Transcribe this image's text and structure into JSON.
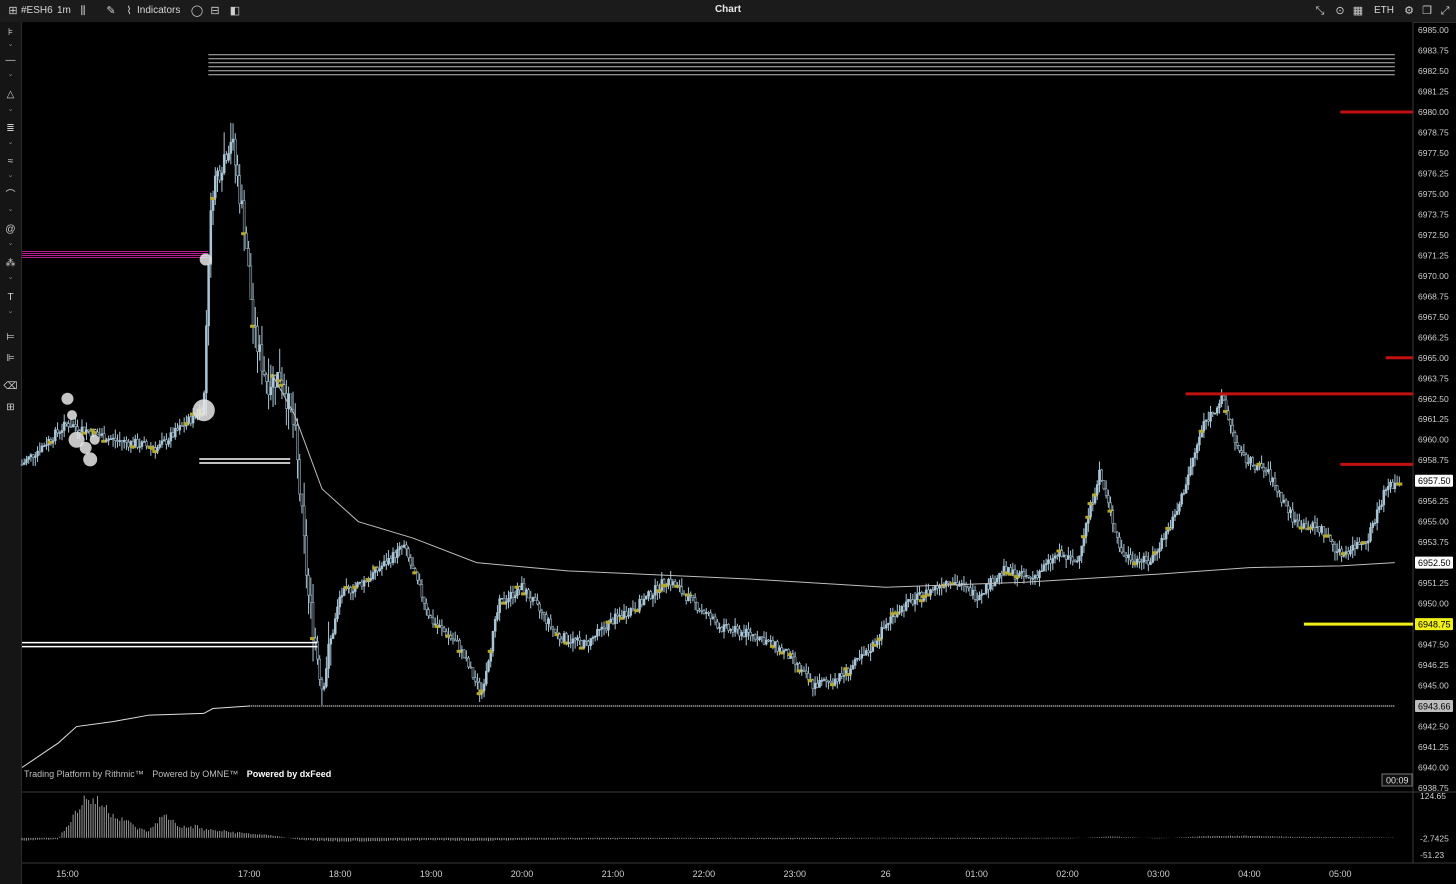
{
  "toolbar": {
    "symbol": "#ESH6",
    "interval": "1m",
    "indicators_label": "Indicators",
    "window_title": "Chart",
    "session": "ETH"
  },
  "left_tools": [
    "cursor-icon",
    "trendline-icon",
    "shapes-icon",
    "fib-icon",
    "pattern-icon",
    "curve-icon",
    "brush-icon",
    "elliott-icon",
    "text-icon",
    "measure-icon",
    "order-icon",
    "eraser-icon",
    "more-tools-icon"
  ],
  "attribution": {
    "rithmic": "Trading Platform by Rithmic™",
    "omne": "Powered by OMNE™",
    "dxfeed": "Powered by dxFeed"
  },
  "colors": {
    "background": "#000000",
    "candle": "#a9c7d8",
    "vwap": "#bdbdbd",
    "resistance": "#c01010",
    "target": "#f0f018",
    "marker": "#b8a82a",
    "magenta": "#b0208f"
  },
  "chart_data": {
    "type": "candlestick",
    "symbol": "#ESH6",
    "interval": "1m",
    "price_axis": {
      "ylim": [
        6938.75,
        6985.0
      ],
      "ticks": [
        "6985.00",
        "6983.75",
        "6982.50",
        "6981.25",
        "6980.00",
        "6978.75",
        "6977.50",
        "6976.25",
        "6975.00",
        "6973.75",
        "6972.50",
        "6971.25",
        "6970.00",
        "6968.75",
        "6967.50",
        "6966.25",
        "6965.00",
        "6963.75",
        "6962.50",
        "6961.25",
        "6960.00",
        "6958.75",
        "6957.50",
        "6956.25",
        "6955.00",
        "6953.75",
        "6952.50",
        "6951.25",
        "6950.00",
        "6948.75",
        "6947.50",
        "6946.25",
        "6945.00",
        "6943.75",
        "6942.50",
        "6941.25",
        "6940.00",
        "6938.75"
      ]
    },
    "time_axis": {
      "labels": [
        "15:00",
        "17:00",
        "18:00",
        "19:00",
        "20:00",
        "21:00",
        "22:00",
        "23:00",
        "26",
        "01:00",
        "02:00",
        "03:00",
        "04:00",
        "05:00"
      ],
      "xlim": [
        14.5,
        29.8
      ]
    },
    "price_path": [
      [
        14.5,
        6958.5
      ],
      [
        15.0,
        6961.0
      ],
      [
        15.5,
        6960.0
      ],
      [
        16.0,
        6959.5
      ],
      [
        16.5,
        6962.0
      ],
      [
        16.55,
        6971.0
      ],
      [
        16.6,
        6975.5
      ],
      [
        16.8,
        6978.5
      ],
      [
        16.95,
        6973.0
      ],
      [
        17.05,
        6966.5
      ],
      [
        17.2,
        6963.5
      ],
      [
        17.35,
        6964.0
      ],
      [
        17.5,
        6960.5
      ],
      [
        17.65,
        6950.5
      ],
      [
        17.8,
        6945.0
      ],
      [
        18.0,
        6950.5
      ],
      [
        18.3,
        6951.5
      ],
      [
        18.7,
        6953.5
      ],
      [
        19.0,
        6949.0
      ],
      [
        19.3,
        6947.5
      ],
      [
        19.55,
        6944.5
      ],
      [
        19.75,
        6950.0
      ],
      [
        20.0,
        6951.0
      ],
      [
        20.4,
        6948.0
      ],
      [
        20.7,
        6947.5
      ],
      [
        21.0,
        6949.0
      ],
      [
        21.3,
        6950.0
      ],
      [
        21.6,
        6951.5
      ],
      [
        21.9,
        6950.0
      ],
      [
        22.2,
        6948.5
      ],
      [
        22.6,
        6948.0
      ],
      [
        22.9,
        6947.0
      ],
      [
        23.2,
        6945.0
      ],
      [
        23.5,
        6945.5
      ],
      [
        23.8,
        6947.0
      ],
      [
        24.1,
        6949.5
      ],
      [
        24.4,
        6950.5
      ],
      [
        24.7,
        6951.5
      ],
      [
        25.0,
        6950.5
      ],
      [
        25.3,
        6952.0
      ],
      [
        25.6,
        6951.5
      ],
      [
        25.9,
        6953.0
      ],
      [
        26.1,
        6952.5
      ],
      [
        26.35,
        6958.0
      ],
      [
        26.6,
        6953.0
      ],
      [
        26.9,
        6952.5
      ],
      [
        27.2,
        6955.5
      ],
      [
        27.5,
        6961.0
      ],
      [
        27.7,
        6962.5
      ],
      [
        27.9,
        6959.0
      ],
      [
        28.2,
        6958.0
      ],
      [
        28.5,
        6955.0
      ],
      [
        28.8,
        6954.5
      ],
      [
        29.0,
        6953.0
      ],
      [
        29.3,
        6954.0
      ],
      [
        29.5,
        6957.0
      ],
      [
        29.65,
        6957.5
      ]
    ],
    "vwap": [
      [
        17.25,
        6964.0
      ],
      [
        17.5,
        6961.5
      ],
      [
        17.8,
        6957.0
      ],
      [
        18.2,
        6955.0
      ],
      [
        18.8,
        6954.0
      ],
      [
        19.5,
        6952.5
      ],
      [
        20.5,
        6952.0
      ],
      [
        22.5,
        6951.5
      ],
      [
        24.0,
        6951.0
      ],
      [
        25.5,
        6951.3
      ],
      [
        27.0,
        6951.8
      ],
      [
        28.0,
        6952.2
      ],
      [
        29.0,
        6952.3
      ],
      [
        29.6,
        6952.5
      ]
    ],
    "horizontal_levels": [
      {
        "price": 6983.0,
        "from": 16.55,
        "to": 29.6,
        "style": "stacked-white"
      },
      {
        "price": 6980.0,
        "from": 29.0,
        "to": 29.85,
        "style": "red"
      },
      {
        "price": 6965.0,
        "from": 29.5,
        "to": 29.85,
        "style": "red"
      },
      {
        "price": 6962.8,
        "from": 27.3,
        "to": 29.85,
        "style": "red"
      },
      {
        "price": 6958.5,
        "from": 29.0,
        "to": 29.85,
        "style": "red"
      },
      {
        "price": 6958.7,
        "from": 16.45,
        "to": 17.45,
        "style": "double-white"
      },
      {
        "price": 6947.5,
        "from": 14.5,
        "to": 17.75,
        "style": "double-white"
      },
      {
        "price": 6948.75,
        "from": 28.6,
        "to": 29.85,
        "style": "yellow"
      },
      {
        "price": 6943.75,
        "from": 17.0,
        "to": 29.6,
        "style": "dotted-gray"
      },
      {
        "price": 6971.3,
        "from": 14.5,
        "to": 16.55,
        "style": "magenta"
      }
    ],
    "price_labels": [
      {
        "text": "6957.50",
        "price": 6957.5,
        "style": "white"
      },
      {
        "text": "6952.50",
        "price": 6952.5,
        "style": "white"
      },
      {
        "text": "6948.75",
        "price": 6948.75,
        "style": "yellow"
      },
      {
        "text": "6943.66",
        "price": 6943.75,
        "style": "gray"
      }
    ],
    "countdown": "00:09",
    "cumulative_delta_curve": [
      [
        14.5,
        6940.0
      ],
      [
        14.9,
        6941.5
      ],
      [
        15.1,
        6942.5
      ],
      [
        15.5,
        6942.8
      ],
      [
        15.9,
        6943.2
      ],
      [
        16.5,
        6943.3
      ],
      [
        16.6,
        6943.6
      ],
      [
        17.0,
        6943.75
      ]
    ],
    "volume_profile_bubbles": [
      {
        "x": 15.0,
        "price": 6962.5,
        "r": 6
      },
      {
        "x": 15.05,
        "price": 6961.5,
        "r": 5
      },
      {
        "x": 15.1,
        "price": 6960.0,
        "r": 8
      },
      {
        "x": 15.2,
        "price": 6959.5,
        "r": 6
      },
      {
        "x": 15.25,
        "price": 6958.8,
        "r": 7
      },
      {
        "x": 15.3,
        "price": 6960.0,
        "r": 5
      },
      {
        "x": 16.52,
        "price": 6971.0,
        "r": 6
      },
      {
        "x": 16.5,
        "price": 6961.8,
        "r": 11
      }
    ],
    "subpanel": {
      "type": "histogram",
      "ticks": [
        "124.65",
        "-2.7425",
        "-51.23"
      ],
      "ylim": [
        -51.23,
        124.65
      ],
      "values": [
        [
          14.5,
          -8
        ],
        [
          14.7,
          -6
        ],
        [
          14.9,
          -4
        ],
        [
          15.0,
          40
        ],
        [
          15.1,
          80
        ],
        [
          15.2,
          120
        ],
        [
          15.3,
          110
        ],
        [
          15.4,
          95
        ],
        [
          15.5,
          70
        ],
        [
          15.6,
          60
        ],
        [
          15.7,
          40
        ],
        [
          15.8,
          25
        ],
        [
          15.9,
          20
        ],
        [
          16.0,
          55
        ],
        [
          16.1,
          65
        ],
        [
          16.2,
          40
        ],
        [
          16.3,
          30
        ],
        [
          16.4,
          35
        ],
        [
          16.5,
          25
        ],
        [
          16.7,
          20
        ],
        [
          16.9,
          15
        ],
        [
          17.1,
          10
        ],
        [
          17.3,
          6
        ],
        [
          17.5,
          -4
        ],
        [
          17.7,
          -8
        ],
        [
          18.0,
          -10
        ],
        [
          18.5,
          -9
        ],
        [
          19.0,
          -7
        ],
        [
          19.5,
          -9
        ],
        [
          20.0,
          -6
        ],
        [
          21.0,
          -4
        ],
        [
          22.0,
          -3
        ],
        [
          23.0,
          -4
        ],
        [
          24.0,
          -2
        ],
        [
          25.0,
          -3
        ],
        [
          26.0,
          -2
        ],
        [
          26.5,
          4
        ],
        [
          27.0,
          -2
        ],
        [
          27.5,
          5
        ],
        [
          28.0,
          6
        ],
        [
          28.5,
          3
        ],
        [
          29.0,
          2
        ],
        [
          29.6,
          1
        ]
      ]
    }
  }
}
